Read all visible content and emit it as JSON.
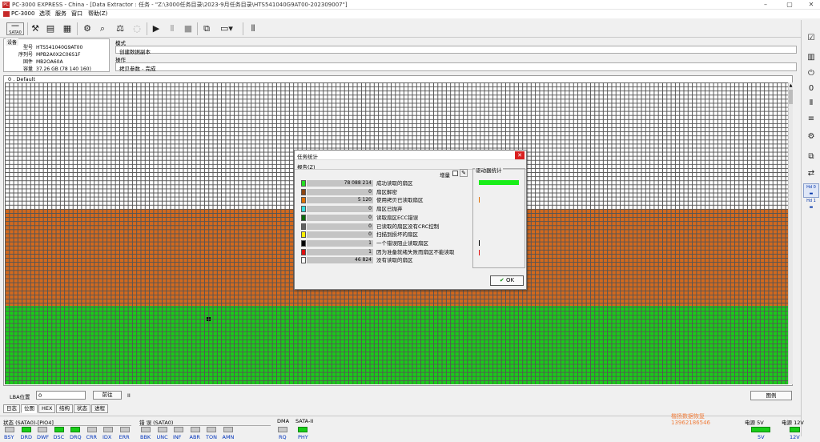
{
  "app": {
    "logo": "PC",
    "title": "PC-3000 EXPRESS - China - [Data Extractor : 任务 - \"Z:\\3000任务目录\\2023-9月任务目录\\HTS541040G9AT00-202309007\"]"
  },
  "menu": [
    "PC-3000",
    "选项",
    "服务",
    "窗口",
    "帮助(Z)"
  ],
  "device": {
    "header": "设备",
    "fields": [
      {
        "k": "型号",
        "v": "HTS541040G9AT00"
      },
      {
        "k": "序列号",
        "v": "MPB2A0X2C06S1F"
      },
      {
        "k": "固件",
        "v": "MB2OA60A"
      },
      {
        "k": "容量",
        "v": "37.26 GB (78 140 160)"
      }
    ]
  },
  "mode": {
    "header": "模式",
    "value": "创建数据副本",
    "op_header": "操作",
    "op_value": "拷贝参数 - 完成"
  },
  "map": {
    "label": "0 . Default",
    "fractions": {
      "white": 0.42,
      "orange": 0.32,
      "green": 0.26
    }
  },
  "lba": {
    "label": "LBA位置",
    "value": "0",
    "goto": "前往",
    "pause": "II",
    "legend_btn": "图例"
  },
  "tabs": [
    "日志",
    "位图",
    "HEX",
    "结构",
    "状态",
    "进程"
  ],
  "status": {
    "group1": "状态 (SATA0)-[PIO4]",
    "group1_leds": [
      {
        "l": "BSY",
        "on": false
      },
      {
        "l": "DRD",
        "on": true
      },
      {
        "l": "DWF",
        "on": false
      },
      {
        "l": "DSC",
        "on": true
      },
      {
        "l": "DRQ",
        "on": true
      },
      {
        "l": "CRR",
        "on": false
      },
      {
        "l": "IDX",
        "on": false
      },
      {
        "l": "ERR",
        "on": false
      }
    ],
    "group2": "错 误 (SATA0)",
    "group2_leds": [
      {
        "l": "BBK",
        "on": false
      },
      {
        "l": "UNC",
        "on": false
      },
      {
        "l": "INF",
        "on": false
      },
      {
        "l": "ABR",
        "on": false
      },
      {
        "l": "TON",
        "on": false
      },
      {
        "l": "AMN",
        "on": false
      }
    ],
    "dma": "DMA",
    "dma_led": "RQ",
    "sata": "SATA-II",
    "sata_led": "PHY",
    "power5": "电源 5V",
    "power5_led": "5V",
    "power12": "电源 12V",
    "power12_led": "12V",
    "watermark1": "楷扬数据恢复",
    "watermark2": "13962186546"
  },
  "dialog": {
    "title": "任务统计",
    "sub": "报告(Z)",
    "incr": "增量",
    "drive_stats": "驱动器统计",
    "ok": "OK",
    "rows": [
      {
        "color": "#22dd22",
        "count": "78 088 214",
        "label": "成功读取的扇区"
      },
      {
        "color": "#8b4513",
        "count": "0",
        "label": "扇区解密"
      },
      {
        "color": "#e07000",
        "count": "5 120",
        "label": "使用拷贝已读取扇区"
      },
      {
        "color": "#33dddd",
        "count": "0",
        "label": "扇区已抛弃"
      },
      {
        "color": "#0a6a0a",
        "count": "0",
        "label": "读取扇区ECC错误"
      },
      {
        "color": "#606060",
        "count": "0",
        "label": "已读取的扇区没有CRC控制"
      },
      {
        "color": "#ffee00",
        "count": "0",
        "label": "扫描到损坏的扇区"
      },
      {
        "color": "#000000",
        "count": "1",
        "label": "一个错误阻止读取扇区"
      },
      {
        "color": "#e01010",
        "count": "1",
        "label": "因为准备就绪失败而扇区不能读取"
      },
      {
        "color": "#ffffff",
        "count": "46 824",
        "label": "没有读取的扇区"
      }
    ]
  },
  "colors": {
    "accent": "#19cc19",
    "orange": "#d2691e",
    "white": "#ffffff",
    "close": "#d82020"
  }
}
